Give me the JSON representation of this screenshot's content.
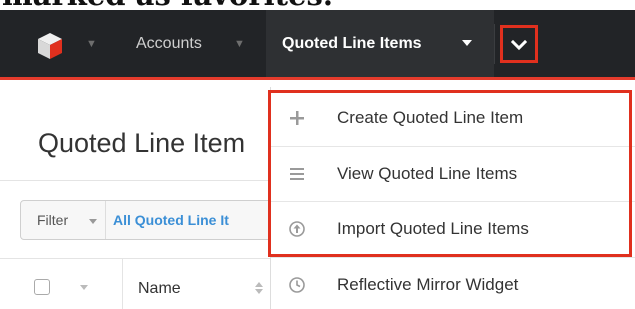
{
  "caption": {
    "text": "marked as favorites."
  },
  "navbar": {
    "logo_icon": "sugar-cube-logo",
    "modules": [
      {
        "label": "Accounts"
      }
    ],
    "active_module": {
      "label": "Quoted Line Items"
    },
    "more_icon": "chevron-down-icon"
  },
  "page": {
    "title": "Quoted Line Item"
  },
  "filter": {
    "label": "Filter",
    "value": "All Quoted Line It"
  },
  "list": {
    "columns": [
      {
        "label": "Name"
      }
    ]
  },
  "dropdown": {
    "items": [
      {
        "label": "Create Quoted Line Item",
        "icon": "plus-icon"
      },
      {
        "label": "View Quoted Line Items",
        "icon": "list-icon"
      },
      {
        "label": "Import Quoted Line Items",
        "icon": "upload-icon"
      },
      {
        "label": "Reflective Mirror Widget",
        "icon": "clock-icon"
      }
    ]
  },
  "colors": {
    "navbar": "#222427",
    "accent_red": "#e0301e",
    "link_blue": "#3b8fd6"
  }
}
